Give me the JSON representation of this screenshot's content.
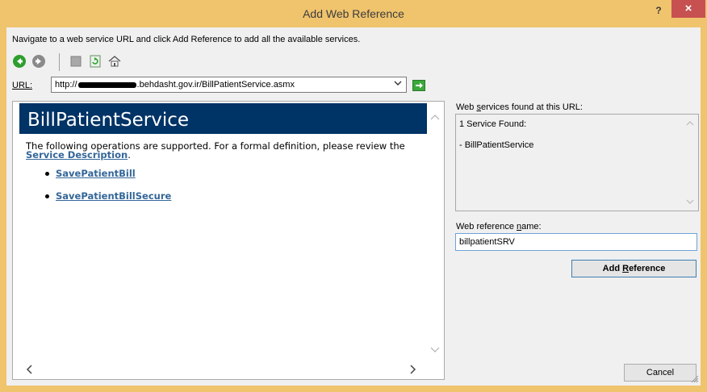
{
  "window": {
    "title": "Add Web Reference",
    "help_label": "?",
    "close_label": "×",
    "frame_color": "#f0c36d"
  },
  "instructions": "Navigate to a web service URL and click Add Reference to add all the available services.",
  "toolbar": {
    "buttons": [
      {
        "name": "back",
        "icon": "arrow-left-icon",
        "color": "#2e9e2e"
      },
      {
        "name": "forward",
        "icon": "arrow-right-icon",
        "color": "#7a7a7a"
      },
      {
        "name": "stop",
        "icon": "stop-icon"
      },
      {
        "name": "refresh",
        "icon": "refresh-icon",
        "color": "#2e9e2e"
      },
      {
        "name": "home",
        "icon": "home-icon"
      }
    ]
  },
  "url_bar": {
    "label": "URL:",
    "value_prefix": "http://",
    "value_suffix": ".behdasht.gov.ir/BillPatientService.asmx",
    "go_icon": "go-arrow-icon"
  },
  "service_page": {
    "title": "BillPatientService",
    "description_text": "The following operations are supported. For a formal definition, please review the",
    "description_link": "Service Description",
    "description_end": ".",
    "operations": [
      "SavePatientBill",
      "SavePatientBillSecure"
    ],
    "header_color": "#003366",
    "link_color": "#336699"
  },
  "found_panel": {
    "label_pre": "Web ",
    "label_accel": "s",
    "label_post": "ervices found at this URL:",
    "line1": "1 Service Found:",
    "line2": "- BillPatientService"
  },
  "reference_name": {
    "label_pre": "Web reference ",
    "label_accel": "n",
    "label_post": "ame:",
    "value": "billpatientSRV"
  },
  "buttons": {
    "add_reference_pre": "Add ",
    "add_reference_accel": "R",
    "add_reference_post": "eference",
    "cancel": "Cancel"
  }
}
